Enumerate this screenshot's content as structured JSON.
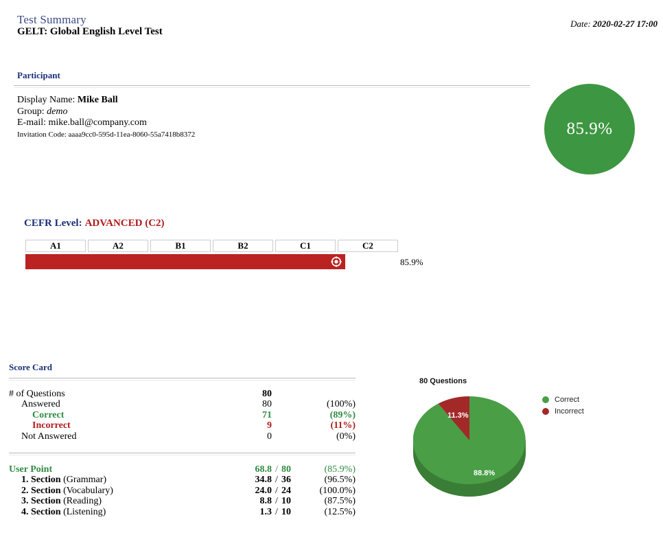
{
  "header": {
    "title": "Test Summary",
    "subtitle": "GELT: Global English Level Test",
    "date_label": "Date:",
    "date_value": "2020-02-27 17:00"
  },
  "participant": {
    "heading": "Participant",
    "display_name_label": "Display Name:",
    "display_name_value": "Mike Ball",
    "group_label": "Group:",
    "group_value": "demo",
    "email_label": "E-mail:",
    "email_value": "mike.ball@company.com",
    "invitation_label": "Invitation Code:",
    "invitation_value": "aaaa9cc0-595d-11ea-8060-55a7418b8372"
  },
  "overall_score": {
    "value": "85.9%",
    "circle_color": "#3d9641"
  },
  "cefr": {
    "label": "CEFR Level:",
    "value": "ADVANCED (C2)",
    "levels": [
      "A1",
      "A2",
      "B1",
      "B2",
      "C1",
      "C2"
    ],
    "percent_text": "85.9%",
    "percent": 85.9,
    "bar_color": "#bb2222",
    "marker_icon": "crosshair-target-icon"
  },
  "scorecard": {
    "heading": "Score Card",
    "rows": [
      {
        "label": "# of Questions",
        "indent": 0,
        "bold_label": false,
        "color": "",
        "value": "80",
        "percent": "",
        "bold_value": true
      },
      {
        "label": "Answered",
        "indent": 1,
        "bold_label": false,
        "color": "",
        "value": "80",
        "percent": "(100%)",
        "bold_value": false
      },
      {
        "label": "Correct",
        "indent": 2,
        "bold_label": true,
        "color": "green",
        "value": "71",
        "percent": "(89%)",
        "bold_value": true
      },
      {
        "label": "Incorrect",
        "indent": 2,
        "bold_label": true,
        "color": "red",
        "value": "9",
        "percent": "(11%)",
        "bold_value": true
      },
      {
        "label": "Not Answered",
        "indent": 1,
        "bold_label": false,
        "color": "",
        "value": "0",
        "percent": "(0%)",
        "bold_value": false
      }
    ]
  },
  "userpoint": {
    "rows": [
      {
        "label": "User Point",
        "sublabel": "",
        "indent": 0,
        "color": "green",
        "score": "68.8",
        "slash": "/",
        "total": "80",
        "percent": "(85.9%)"
      },
      {
        "label": "1. Section",
        "sublabel": "(Grammar)",
        "indent": 1,
        "color": "",
        "score": "34.8",
        "slash": "/",
        "total": "36",
        "percent": "(96.5%)"
      },
      {
        "label": "2. Section",
        "sublabel": "(Vocabulary)",
        "indent": 1,
        "color": "",
        "score": "24.0",
        "slash": "/",
        "total": "24",
        "percent": "(100.0%)"
      },
      {
        "label": "3. Section",
        "sublabel": "(Reading)",
        "indent": 1,
        "color": "",
        "score": "8.8",
        "slash": "/",
        "total": "10",
        "percent": "(87.5%)"
      },
      {
        "label": "4. Section",
        "sublabel": "(Listening)",
        "indent": 1,
        "color": "",
        "score": "1.3",
        "slash": "/",
        "total": "10",
        "percent": "(12.5%)"
      }
    ]
  },
  "chart_data": {
    "type": "pie",
    "title": "80 Questions",
    "categories": [
      "Correct",
      "Incorrect"
    ],
    "values": [
      88.8,
      11.3
    ],
    "value_labels": [
      "88.8%",
      "11.3%"
    ],
    "colors": [
      "#4a9e46",
      "#a32929"
    ],
    "side_colors": [
      "#3a7d36",
      "#832020"
    ],
    "legend": [
      {
        "label": "Correct",
        "color": "#4a9e46"
      },
      {
        "label": "Incorrect",
        "color": "#a32929"
      }
    ],
    "legend_position": "right",
    "three_d": true
  }
}
